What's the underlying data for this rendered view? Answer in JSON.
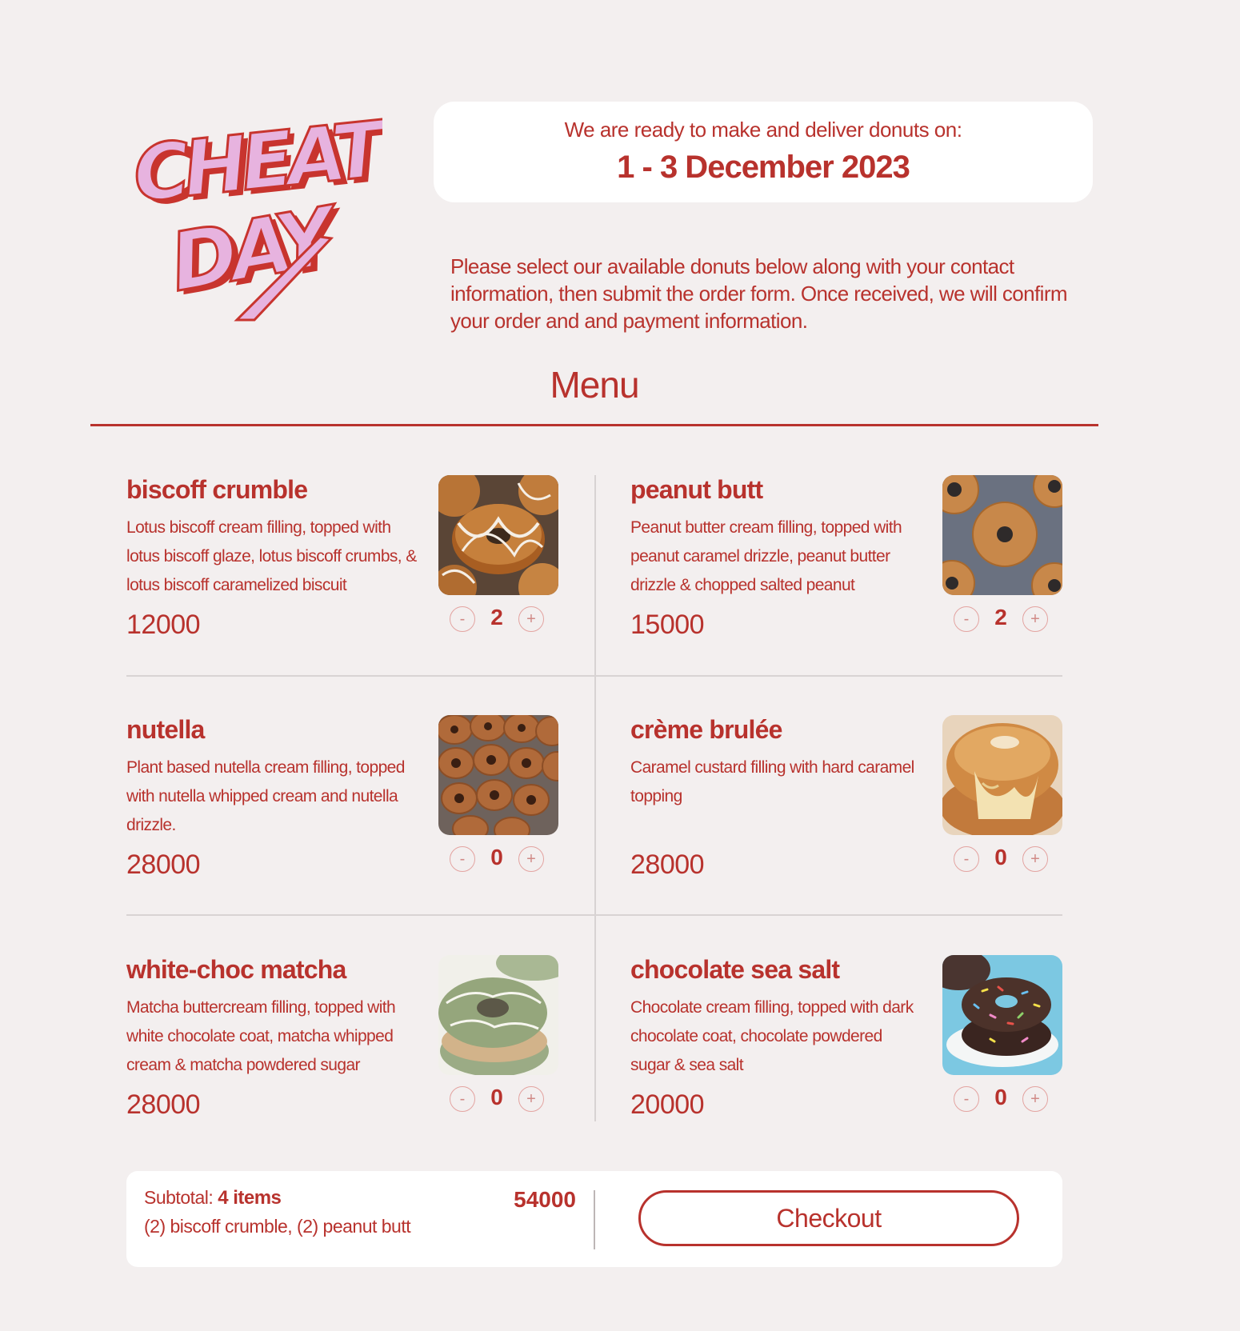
{
  "brand": {
    "logo_lines": [
      "CHEAT",
      "DAY"
    ],
    "colors": {
      "primary": "#b8322d",
      "logo_fill": "#e7b3df",
      "background": "#f3efef"
    }
  },
  "availability": {
    "label": "We are ready to make and deliver donuts on:",
    "dates": "1 - 3 December 2023"
  },
  "intro": "Please select our available donuts below along with your contact information, then submit the order form. Once received, we will confirm your order and and payment information.",
  "menu": {
    "heading": "Menu",
    "items": [
      {
        "name": "biscoff crumble",
        "description": "Lotus biscoff cream filling, topped with lotus biscoff glaze, lotus biscoff crumbs, & lotus biscoff caramelized biscuit",
        "price": "12000",
        "quantity": "2",
        "image_icon": "biscoff-donut-photo"
      },
      {
        "name": "peanut butt",
        "description": "Peanut butter cream filling, topped with peanut caramel drizzle, peanut butter drizzle & chopped salted peanut",
        "price": "15000",
        "quantity": "2",
        "image_icon": "peanut-donut-photo"
      },
      {
        "name": "nutella",
        "description": "Plant based nutella cream filling, topped with nutella whipped cream and nutella drizzle.",
        "price": "28000",
        "quantity": "0",
        "image_icon": "nutella-donut-photo"
      },
      {
        "name": "crème brulée",
        "description": "Caramel custard filling with hard caramel topping",
        "price": "28000",
        "quantity": "0",
        "image_icon": "creme-brulee-donut-photo"
      },
      {
        "name": "white-choc matcha",
        "description": "Matcha buttercream filling, topped with white chocolate coat, matcha whipped cream & matcha powdered sugar",
        "price": "28000",
        "quantity": "0",
        "image_icon": "matcha-donut-photo"
      },
      {
        "name": "chocolate sea salt",
        "description": "Chocolate cream filling, topped with dark chocolate coat, chocolate powdered sugar & sea salt",
        "price": "20000",
        "quantity": "0",
        "image_icon": "chocolate-donut-photo"
      }
    ],
    "stepper": {
      "minus": "-",
      "plus": "+"
    }
  },
  "summary": {
    "subtotal_label": "Subtotal:",
    "item_count": "4 items",
    "items_text": "(2) biscoff crumble, (2) peanut butt",
    "total": "54000",
    "checkout_label": "Checkout"
  }
}
